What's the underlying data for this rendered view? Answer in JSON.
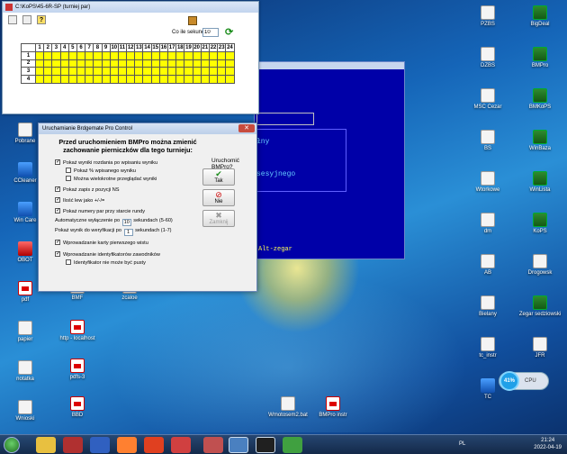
{
  "desktop": {
    "left_icons": [
      {
        "label": "Pobrane",
        "kind": "doc"
      },
      {
        "label": "CCleaner",
        "kind": "blue"
      },
      {
        "label": "Win Care",
        "kind": "blue"
      },
      {
        "label": "OBOT",
        "kind": "red"
      },
      {
        "label": "pdf",
        "kind": "pdf"
      },
      {
        "label": "papier",
        "kind": "doc"
      },
      {
        "label": "notatka",
        "kind": "doc"
      },
      {
        "label": "Wnioski",
        "kind": "doc"
      }
    ],
    "mid_icons": [
      {
        "label": "BMF",
        "kind": "doc"
      },
      {
        "label": "http - localhost",
        "kind": "pdf"
      },
      {
        "label": "pdfs-3",
        "kind": "pdf"
      },
      {
        "label": "BBD",
        "kind": "pdf"
      },
      {
        "label": "zcaloe",
        "kind": "doc"
      },
      {
        "label": "Wmotosem2.bat",
        "kind": "doc"
      },
      {
        "label": "BMPro instr",
        "kind": "pdf"
      }
    ],
    "right_icons_col1": [
      {
        "label": "PZBS",
        "kind": "doc"
      },
      {
        "label": "DZBS",
        "kind": "doc"
      },
      {
        "label": "MSC Cezar",
        "kind": "doc"
      },
      {
        "label": "BS",
        "kind": "doc"
      },
      {
        "label": "Wtorkowe",
        "kind": "doc"
      },
      {
        "label": "dm",
        "kind": "doc"
      },
      {
        "label": "AB",
        "kind": "doc"
      },
      {
        "label": "Bielany",
        "kind": "doc"
      },
      {
        "label": "tc_instr",
        "kind": "doc"
      },
      {
        "label": "TC",
        "kind": "blue"
      }
    ],
    "right_icons_col2": [
      {
        "label": "BigDeal",
        "kind": "app"
      },
      {
        "label": "BMPro",
        "kind": "app"
      },
      {
        "label": "BMKoPS",
        "kind": "app"
      },
      {
        "label": "WinBaza",
        "kind": "app"
      },
      {
        "label": "WinLista",
        "kind": "app"
      },
      {
        "label": "KoPS",
        "kind": "app"
      },
      {
        "label": "Drogowsk",
        "kind": "doc"
      },
      {
        "label": "Zegar sedziowski",
        "kind": "app"
      },
      {
        "label": "JFR",
        "kind": "doc"
      }
    ]
  },
  "console": {
    "line1": "łny",
    "line2": "sesyjnego",
    "bottom": "Alt-zegar"
  },
  "kops_window": {
    "title": "C:\\KoPS\\45-6R-SP (turniej par)",
    "sek_label": "Co ile sekund",
    "sek_value": "10",
    "columns": [
      "1",
      "2",
      "3",
      "4",
      "5",
      "6",
      "7",
      "8",
      "9",
      "10",
      "11",
      "12",
      "13",
      "14",
      "15",
      "16",
      "17",
      "18",
      "19",
      "20",
      "21",
      "22",
      "23",
      "24"
    ],
    "rows": [
      "1",
      "2",
      "3",
      "4"
    ]
  },
  "dialog": {
    "title": "Uruchamianie Brdgemate Pro Control",
    "heading_line1": "Przed uruchomieniem BMPro można zmienić",
    "heading_line2": "zachowanie pierniczków dla tego turnieju:",
    "question": "Uruchomić BMPro?",
    "btn_yes": "Tak",
    "btn_no": "Nie",
    "btn_close": "Zamknij",
    "opt1": "Pokaż wyniki rozdania po wpisaniu wyniku",
    "opt1a": "Pokaż % wpisanego wyniku",
    "opt1b": "Można wielokrotne przeglądać wyniki",
    "opt2": "Pokaż zapis z pozycji NS",
    "opt3": "Ilość lew jako +/-/=",
    "opt4": "Pokaż numery par przy starcie rundy",
    "auto_pre": "Automatyczne wyłączenie po",
    "auto_val": "10",
    "auto_post": "sekundach (5-60)",
    "show_pre": "Pokaż wynik do weryfikacji po",
    "show_val": "1",
    "show_post": "sekundach (1-7)",
    "opt5": "Wprowadzanie karty pierwszego wistu",
    "opt6": "Wprowadzanie identyfikatorów zawodników",
    "opt6a": "Identyfikator nie może być pusty"
  },
  "taskbar": {
    "time": "21:24",
    "date": "2022-04-19",
    "lang": "PL"
  },
  "cpu": {
    "percent": "41%",
    "label": "CPU"
  }
}
